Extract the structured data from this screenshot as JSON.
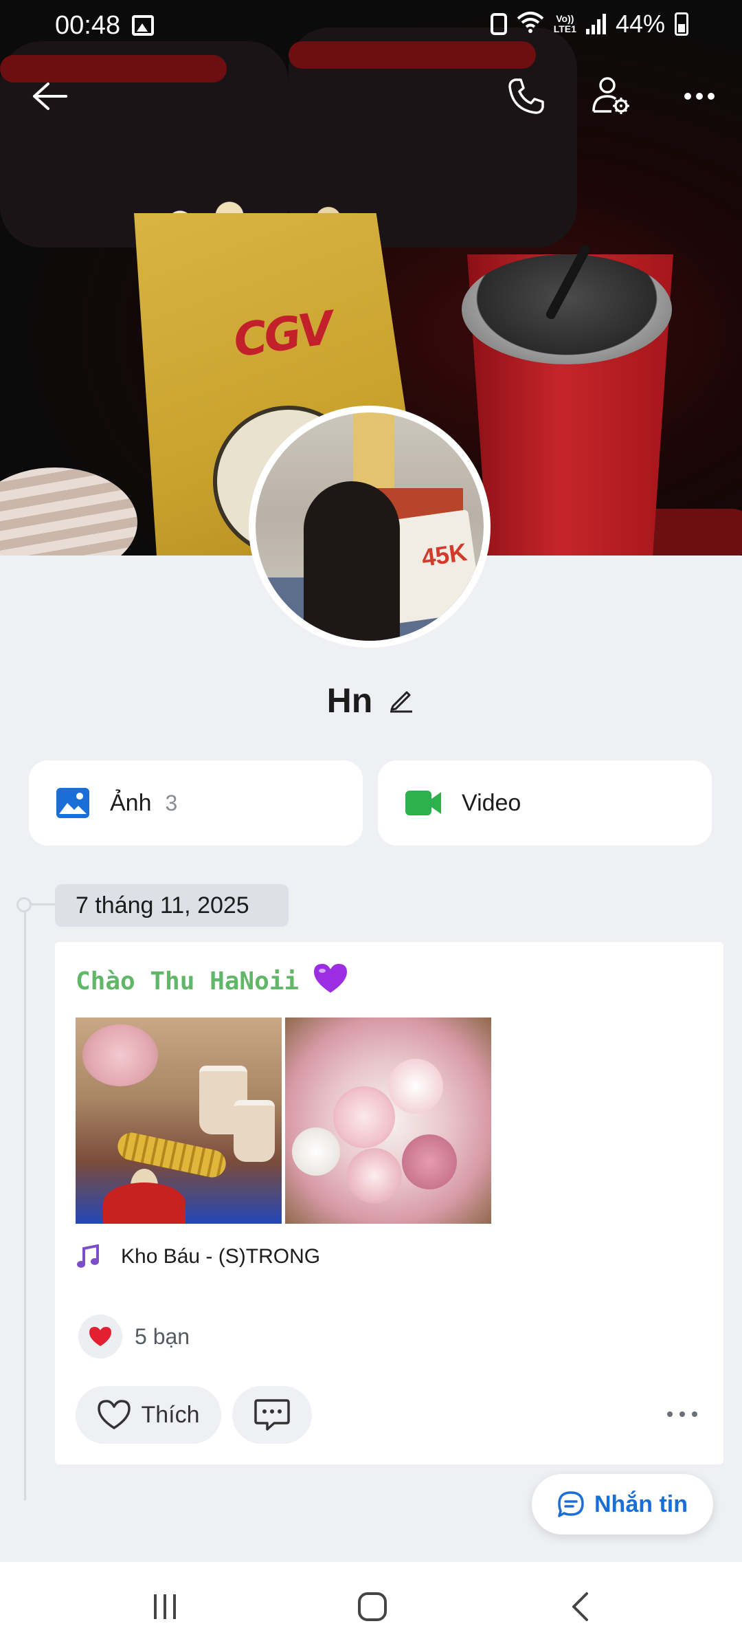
{
  "status_bar": {
    "time": "00:48",
    "network": "Vo))\nLTE1",
    "battery": "44%"
  },
  "profile": {
    "name": "Hn"
  },
  "media": {
    "photos_label": "Ảnh",
    "photos_count": "3",
    "video_label": "Video"
  },
  "timeline": {
    "date": "7 tháng 11, 2025"
  },
  "post": {
    "title": "Chào Thu HaNoii",
    "title_emoji": "purple-heart",
    "music": "Kho Báu - (S)TRONG",
    "likes_text": "5 bạn",
    "like_button": "Thích"
  },
  "fab": {
    "message_label": "Nhắn tin"
  },
  "icons": {
    "back": "back-arrow-icon",
    "call": "phone-icon",
    "profile_settings": "user-settings-icon",
    "more": "more-icon",
    "photos": "image-icon",
    "video": "video-camera-icon",
    "edit": "pencil-icon",
    "music": "music-note-icon",
    "heart": "heart-icon",
    "comment": "comment-icon"
  },
  "colors": {
    "accent_blue": "#1a6ed8",
    "video_green": "#2bb24c",
    "post_title_green": "#5fb767",
    "heart_red": "#e2202f",
    "music_purple": "#7b4fc9"
  }
}
